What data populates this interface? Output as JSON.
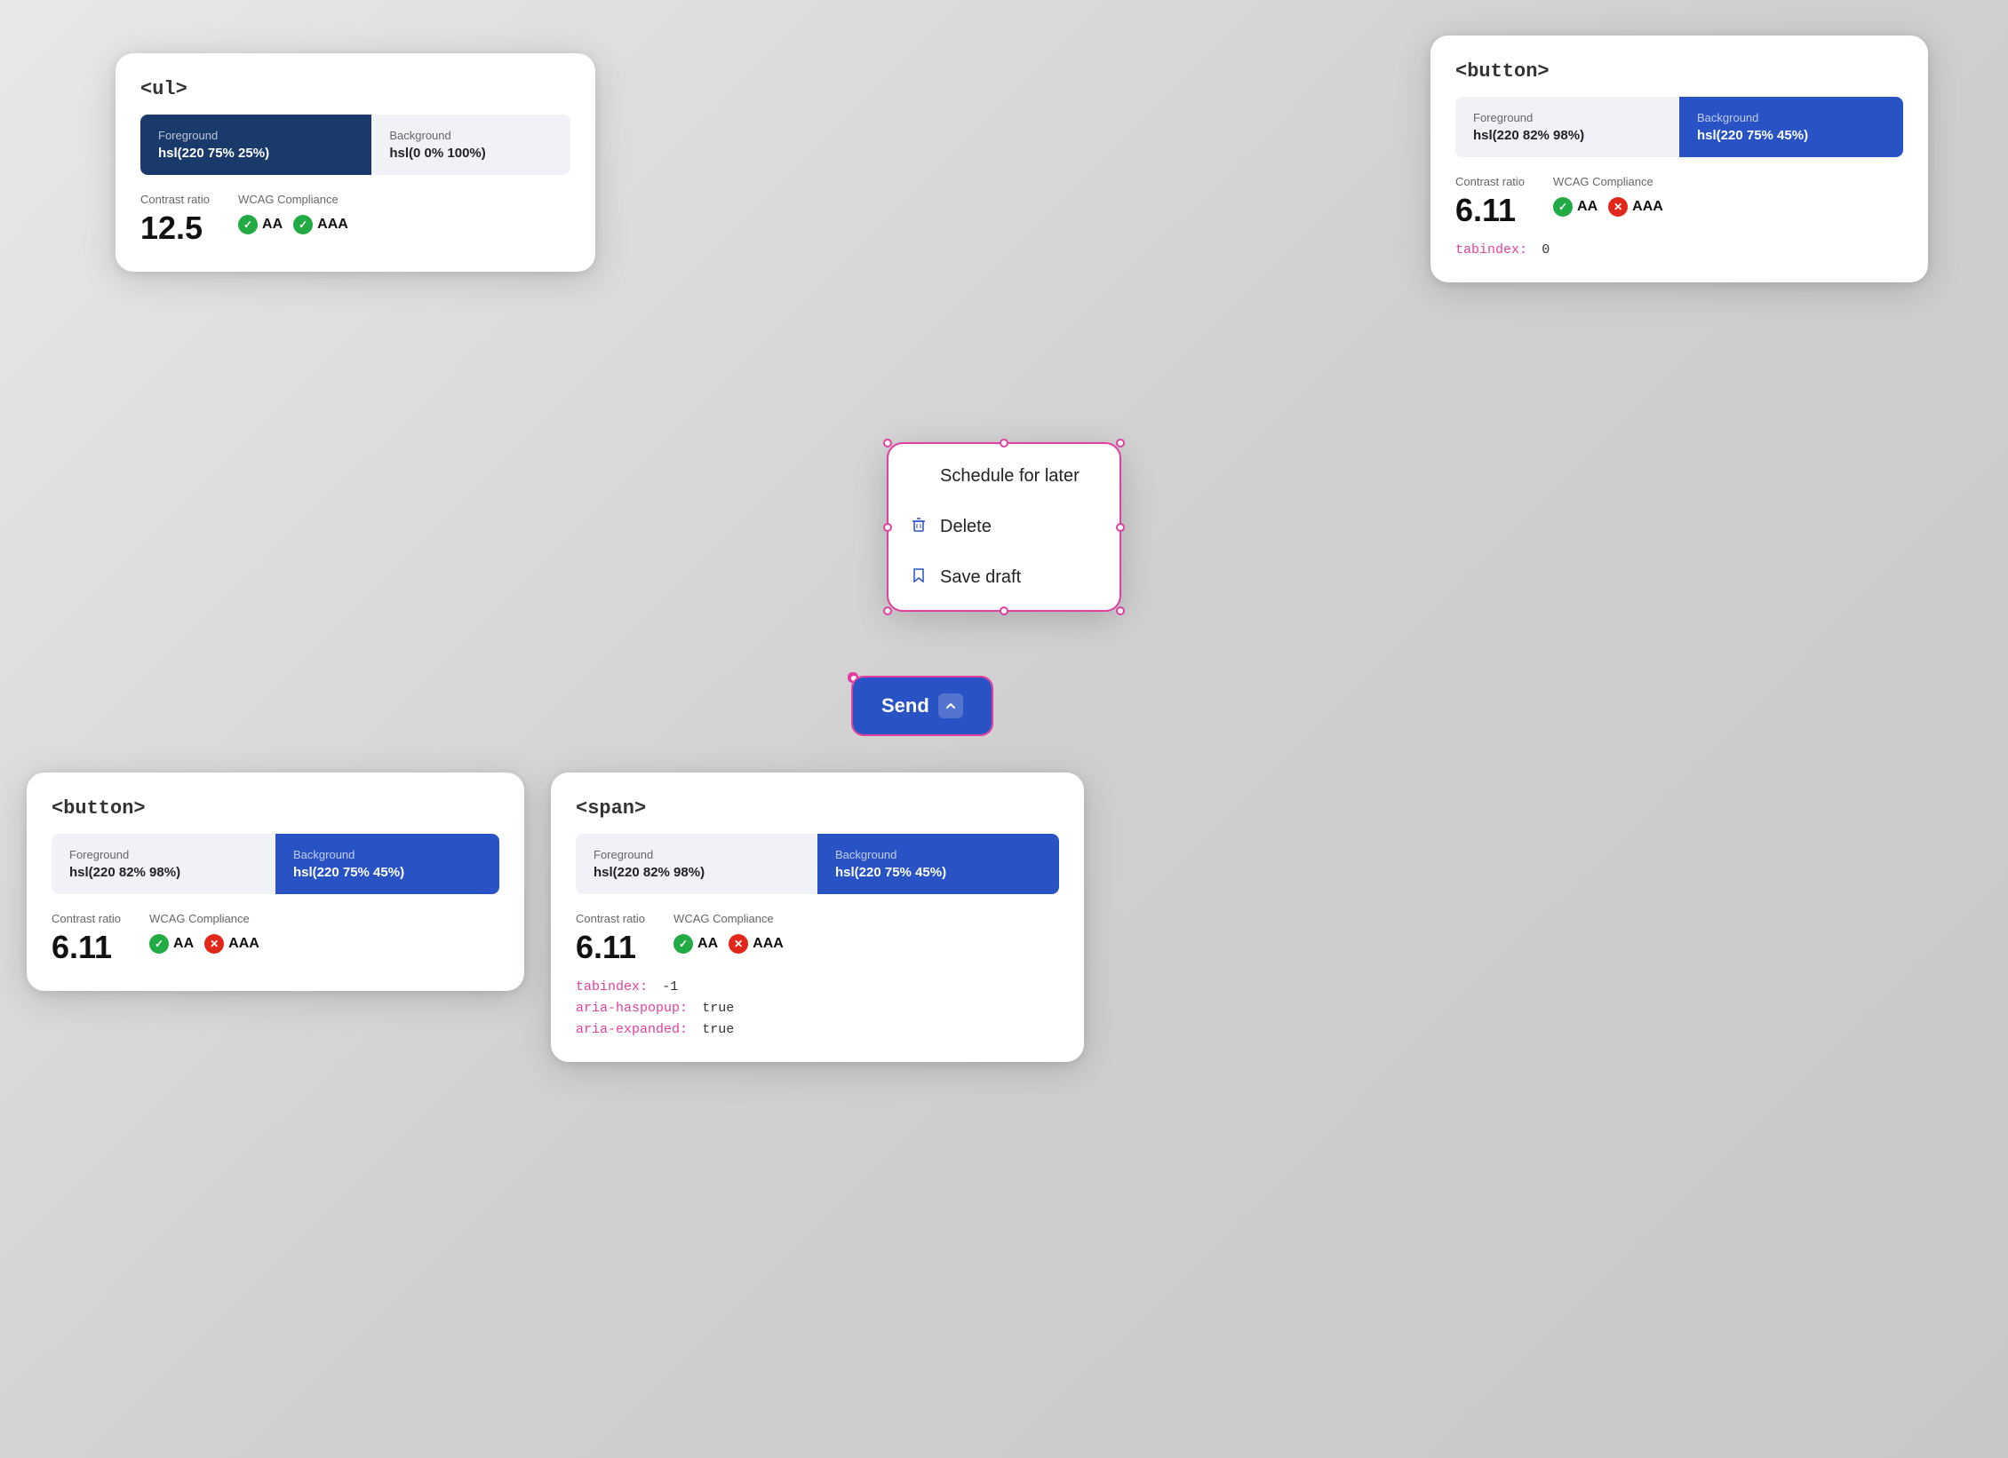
{
  "cards": {
    "top_left": {
      "title": "<ul>",
      "foreground": {
        "label": "Foreground",
        "value": "hsl(220 75% 25%)"
      },
      "background": {
        "label": "Background",
        "value": "hsl(0 0% 100%)"
      },
      "contrast_ratio_label": "Contrast ratio",
      "contrast_ratio_value": "12.5",
      "wcag_label": "WCAG Compliance",
      "wcag_aa": "AA",
      "wcag_aaa": "AAA"
    },
    "top_right": {
      "title": "<button>",
      "foreground": {
        "label": "Foreground",
        "value": "hsl(220 82% 98%)"
      },
      "background": {
        "label": "Background",
        "value": "hsl(220 75% 45%)"
      },
      "contrast_ratio_label": "Contrast ratio",
      "contrast_ratio_value": "6.11",
      "wcag_label": "WCAG Compliance",
      "wcag_aa": "AA",
      "wcag_aaa": "AAA",
      "tabindex_label": "tabindex:",
      "tabindex_value": "0"
    },
    "bottom_left": {
      "title": "<button>",
      "foreground": {
        "label": "Foreground",
        "value": "hsl(220 82% 98%)"
      },
      "background": {
        "label": "Background",
        "value": "hsl(220 75% 45%)"
      },
      "contrast_ratio_label": "Contrast ratio",
      "contrast_ratio_value": "6.11",
      "wcag_label": "WCAG Compliance",
      "wcag_aa": "AA",
      "wcag_aaa": "AAA"
    },
    "bottom_right": {
      "title": "<span>",
      "foreground": {
        "label": "Foreground",
        "value": "hsl(220 82% 98%)"
      },
      "background": {
        "label": "Background",
        "value": "hsl(220 75% 45%)"
      },
      "contrast_ratio_label": "Contrast ratio",
      "contrast_ratio_value": "6.11",
      "wcag_label": "WCAG Compliance",
      "wcag_aa": "AA",
      "wcag_aaa": "AAA",
      "tabindex_label": "tabindex:",
      "tabindex_value": "-1",
      "aria_haspopup_label": "aria-haspopup:",
      "aria_haspopup_value": "true",
      "aria_expanded_label": "aria-expanded:",
      "aria_expanded_value": "true"
    }
  },
  "dropdown": {
    "items": [
      {
        "label": "Schedule for later",
        "icon": "calendar"
      },
      {
        "label": "Delete",
        "icon": "trash"
      },
      {
        "label": "Save draft",
        "icon": "bookmark"
      }
    ]
  },
  "send_button": {
    "label": "Send",
    "chevron": "▲"
  }
}
